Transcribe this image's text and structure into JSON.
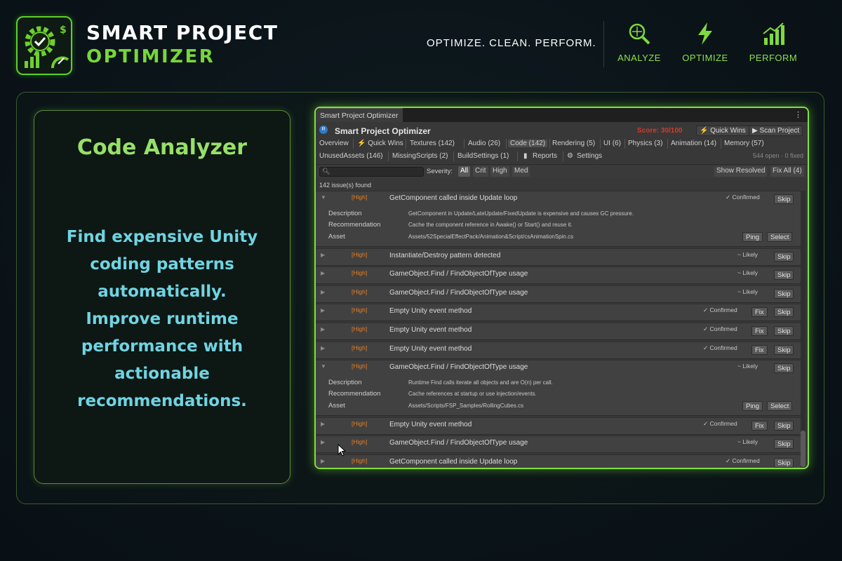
{
  "brand": {
    "title": "SMART PROJECT",
    "subtitle": "OPTIMIZER",
    "tagline": "OPTIMIZE. CLEAN. PERFORM.",
    "accent": "#77d63a"
  },
  "features": [
    {
      "label": "ANALYZE",
      "icon": "magnify-icon"
    },
    {
      "label": "OPTIMIZE",
      "icon": "lightning-icon"
    },
    {
      "label": "PERFORM",
      "icon": "bar-chart-icon"
    }
  ],
  "panel": {
    "title": "Code Analyzer",
    "description": "Find expensive Unity\ncoding patterns\nautomatically.\nImprove runtime\nperformance with\nactionable\nrecommendations."
  },
  "window": {
    "tab": "Smart Project Optimizer",
    "title": "Smart Project Optimizer",
    "score": "Score: 30/100",
    "quick_wins_btn": "⚡ Quick Wins",
    "scan_btn": "▶ Scan Project",
    "tabs_row1": [
      "Overview",
      "⚡ Quick Wins",
      "Textures (142)",
      "Audio (26)",
      "Code (142)",
      "Rendering (5)",
      "UI (6)",
      "Physics (3)",
      "Animation (14)",
      "Memory (57)"
    ],
    "tabs_row2": [
      "UnusedAssets (146)",
      "MissingScripts (2)",
      "BuildSettings (1)",
      "Reports",
      "Settings"
    ],
    "open_fixed": "544 open · 0 fixed",
    "severity_label": "Severity:",
    "severity_chips": [
      "All",
      "Crit",
      "High",
      "Med"
    ],
    "show_resolved": "Show Resolved",
    "fix_all": "Fix All (4)",
    "issue_count": "142 issue(s) found"
  },
  "labels": {
    "description": "Description",
    "recommendation": "Recommendation",
    "asset": "Asset",
    "fix": "Fix",
    "skip": "Skip",
    "ping": "Ping",
    "select": "Select"
  },
  "issues": [
    {
      "severity": "[High]",
      "title": "GetComponent called inside Update loop",
      "status": "✓ Confirmed",
      "expanded": true,
      "fix": false,
      "description": "GetComponent in Update/LateUpdate/FixedUpdate is expensive and causes GC pressure.",
      "recommendation": "Cache the component reference in Awake() or Start() and reuse it.",
      "asset": "Assets/52SpecialEffectPack/Animation&Script/csAnimationSpin.cs"
    },
    {
      "severity": "[High]",
      "title": "Instantiate/Destroy pattern detected",
      "status": "~ Likely",
      "expanded": false,
      "fix": false
    },
    {
      "severity": "[High]",
      "title": "GameObject.Find / FindObjectOfType usage",
      "status": "~ Likely",
      "expanded": false,
      "fix": false
    },
    {
      "severity": "[High]",
      "title": "GameObject.Find / FindObjectOfType usage",
      "status": "~ Likely",
      "expanded": false,
      "fix": false
    },
    {
      "severity": "[High]",
      "title": "Empty Unity event method",
      "status": "✓ Confirmed",
      "expanded": false,
      "fix": true
    },
    {
      "severity": "[High]",
      "title": "Empty Unity event method",
      "status": "✓ Confirmed",
      "expanded": false,
      "fix": true
    },
    {
      "severity": "[High]",
      "title": "Empty Unity event method",
      "status": "✓ Confirmed",
      "expanded": false,
      "fix": true
    },
    {
      "severity": "[High]",
      "title": "GameObject.Find / FindObjectOfType usage",
      "status": "~ Likely",
      "expanded": true,
      "fix": false,
      "description": "Runtime Find calls iterate all objects and are O(n) per call.",
      "recommendation": "Cache references at startup or use injection/events.",
      "asset": "Assets/Scripts/FSP_Samples/RollingCubes.cs"
    },
    {
      "severity": "[High]",
      "title": "Empty Unity event method",
      "status": "✓ Confirmed",
      "expanded": false,
      "fix": true
    },
    {
      "severity": "[High]",
      "title": "GameObject.Find / FindObjectOfType usage",
      "status": "~ Likely",
      "expanded": false,
      "fix": false
    },
    {
      "severity": "[High]",
      "title": "GetComponent called inside Update loop",
      "status": "✓ Confirmed",
      "expanded": false,
      "fix": false
    }
  ]
}
